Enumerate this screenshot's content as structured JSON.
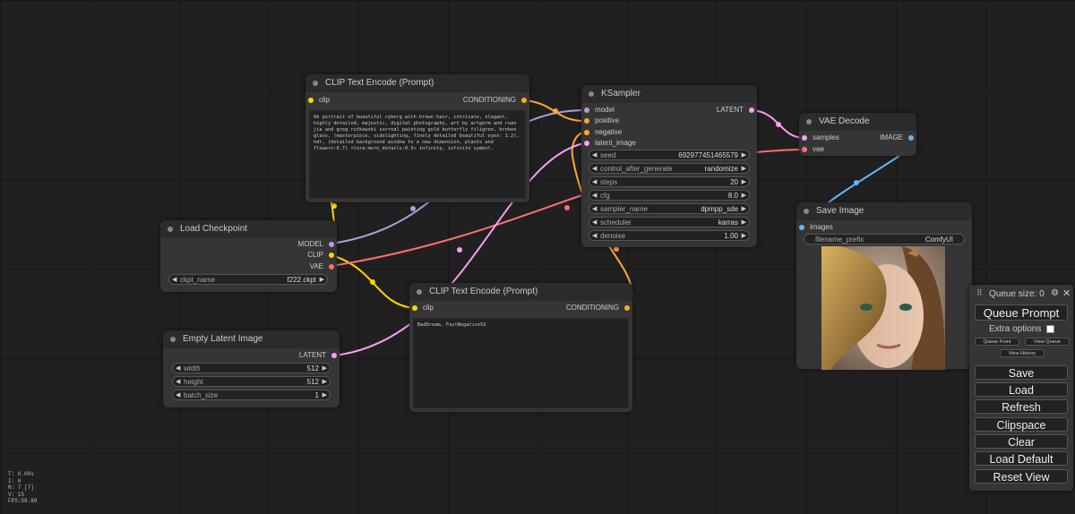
{
  "colors": {
    "model": "#b39ddb",
    "clip": "#ffd500",
    "conditioning": "#ffa931",
    "latent": "#ff9cf9",
    "vae": "#ff6e6e",
    "image": "#64b5f6"
  },
  "clip_top": {
    "title": "CLIP Text Encode (Prompt)",
    "input": "clip",
    "output": "CONDITIONING",
    "text": "8k portrait of beautiful cyborg with brown hair, intricate, elegant, highly detailed, majestic, digital photography, art by artgerm and ruan jia and greg rutkowski surreal painting gold butterfly filigree, broken glass, (masterpiece, sidelighting, finely detailed beautiful eyes: 1.2), hdr, (detailed background window to a new dimension, plants and flowers:0.7) <lora:more_details:0.5> infinity, infinite symbol,"
  },
  "clip_bottom": {
    "title": "CLIP Text Encode (Prompt)",
    "input": "clip",
    "output": "CONDITIONING",
    "text": "BadDream, FastNegativeV2"
  },
  "load_checkpoint": {
    "title": "Load Checkpoint",
    "outputs": [
      "MODEL",
      "CLIP",
      "VAE"
    ],
    "widget": {
      "label": "ckpt_name",
      "value": "f222.ckpt"
    }
  },
  "empty_latent": {
    "title": "Empty Latent Image",
    "output": "LATENT",
    "widgets": [
      {
        "label": "width",
        "value": "512"
      },
      {
        "label": "height",
        "value": "512"
      },
      {
        "label": "batch_size",
        "value": "1"
      }
    ]
  },
  "ksampler": {
    "title": "KSampler",
    "inputs": [
      "model",
      "positive",
      "negative",
      "latent_image"
    ],
    "output": "LATENT",
    "widgets": [
      {
        "label": "seed",
        "value": "692977451465579"
      },
      {
        "label": "control_after_generate",
        "value": "randomize"
      },
      {
        "label": "steps",
        "value": "20"
      },
      {
        "label": "cfg",
        "value": "8.0"
      },
      {
        "label": "sampler_name",
        "value": "dpmpp_sde"
      },
      {
        "label": "scheduler",
        "value": "karras"
      },
      {
        "label": "denoise",
        "value": "1.00"
      }
    ]
  },
  "vae_decode": {
    "title": "VAE Decode",
    "inputs": [
      "samples",
      "vae"
    ],
    "output": "IMAGE"
  },
  "save_image": {
    "title": "Save Image",
    "input": "images",
    "widget": {
      "label": "filename_prefix",
      "value": "ComfyUI"
    }
  },
  "menu": {
    "queue_size": "Queue size: 0",
    "queue_prompt": "Queue Prompt",
    "extra_options": "Extra options",
    "queue_front": "Queue Front",
    "view_queue": "View Queue",
    "view_history": "View History",
    "buttons": [
      "Save",
      "Load",
      "Refresh",
      "Clipspace",
      "Clear",
      "Load Default",
      "Reset View"
    ]
  },
  "stats": {
    "t": "T: 0.00s",
    "i": "I: 0",
    "n": "N: 7 [7]",
    "v": "V: 15",
    "fps": "FPS:59.88"
  }
}
